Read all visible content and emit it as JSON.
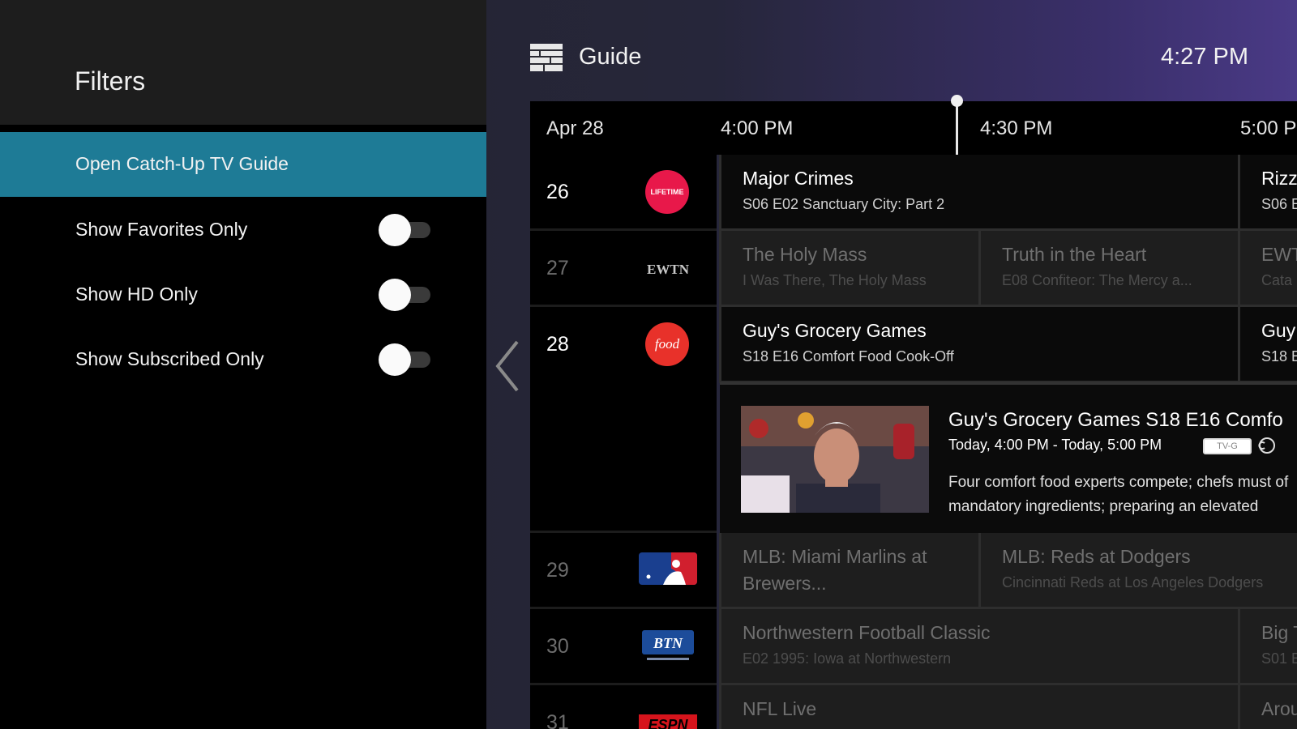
{
  "filters": {
    "title": "Filters",
    "items": [
      {
        "label": "Open Catch-Up TV Guide",
        "selected": true,
        "has_toggle": false
      },
      {
        "label": "Show Favorites Only",
        "selected": false,
        "has_toggle": true,
        "on": false
      },
      {
        "label": "Show HD Only",
        "selected": false,
        "has_toggle": true,
        "on": false
      },
      {
        "label": "Show Subscribed Only",
        "selected": false,
        "has_toggle": true,
        "on": false
      }
    ]
  },
  "guide": {
    "title": "Guide",
    "icon": "guide-grid-icon",
    "clock": "4:27 PM",
    "date": "Apr 28",
    "times": [
      "4:00 PM",
      "4:30 PM",
      "5:00 P"
    ],
    "rows": [
      {
        "channel": "26",
        "logo": "lifetime-logo",
        "logo_text": "LIFETIME",
        "programs": [
          {
            "title": "Major Crimes",
            "subtitle": "S06 E02 Sanctuary City: Part 2"
          },
          {
            "title": "Rizzo",
            "subtitle": "S06 E"
          }
        ]
      },
      {
        "channel": "27",
        "logo": "ewtn-logo",
        "logo_text": "EWTN",
        "programs": [
          {
            "title": "The Holy Mass",
            "subtitle": "I Was There, The Holy Mass"
          },
          {
            "title": "Truth in the Heart",
            "subtitle": "E08 Confiteor: The Mercy a..."
          },
          {
            "title": "EWT",
            "subtitle": "Cata"
          }
        ]
      },
      {
        "channel": "28",
        "logo": "food-network-logo",
        "logo_text": "food",
        "programs": [
          {
            "title": "Guy's Grocery Games",
            "subtitle": "S18 E16 Comfort Food Cook-Off"
          },
          {
            "title": "Guy",
            "subtitle": "S18 E"
          }
        ]
      },
      {
        "channel": "29",
        "logo": "mlb-logo",
        "logo_text": "",
        "programs": [
          {
            "title": "MLB: Miami Marlins at",
            "subtitle": "Brewers..."
          },
          {
            "title": "MLB: Reds at Dodgers",
            "subtitle": "Cincinnati Reds at Los Angeles Dodgers"
          }
        ]
      },
      {
        "channel": "30",
        "logo": "btn-logo",
        "logo_text": "BTN",
        "programs": [
          {
            "title": "Northwestern Football Classic",
            "subtitle": "E02 1995: Iowa at Northwestern"
          },
          {
            "title": "Big T",
            "subtitle": "S01 E"
          }
        ]
      },
      {
        "channel": "31",
        "logo": "espn-logo",
        "logo_text": "ESPN",
        "programs": [
          {
            "title": "NFL Live",
            "subtitle": ""
          },
          {
            "title": "Arou",
            "subtitle": ""
          }
        ]
      }
    ],
    "detail": {
      "title": "Guy's Grocery Games S18 E16 Comfo",
      "time": "Today, 4:00 PM - Today, 5:00 PM",
      "rating": "TV-G",
      "description": "Four comfort food experts compete; chefs must of mandatory ingredients; preparing an elevated"
    }
  },
  "colors": {
    "selected_filter": "#1e7b96",
    "lifetime": "#e8184a",
    "food": "#e8312a",
    "mlb_blue": "#1a3f8f",
    "mlb_red": "#d11f2e",
    "btn": "#1c4c9a",
    "espn": "#d6141c"
  }
}
